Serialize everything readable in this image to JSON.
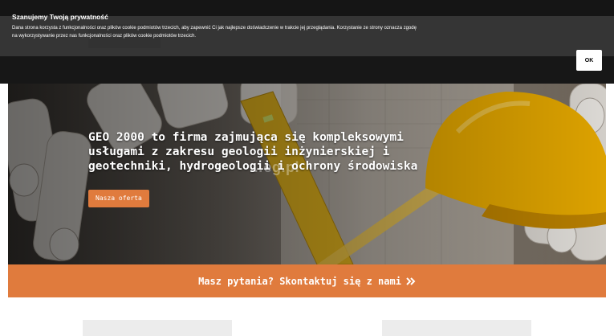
{
  "cookie": {
    "title": "Szanujemy Twoją prywatność",
    "text": "Dana strona korzysta z funkcjonalności oraz plików cookie podmiotów trzecich, aby zapewnić Ci jak najlepsze doświadczenie w trakcie jej przeglądania. Korzystanie ze strony oznacza zgodę na wykorzystywanie przez nas funkcjonalności oraz plików cookie podmiotów trzecich.",
    "ok_label": "OK"
  },
  "hero": {
    "title": "GEO 2000 to firma zajmująca się kompleksowymi usługami z zakresu geologii inżynierskiej i geotechniki, hydrogeologii i ochrony środowiska",
    "button_label": "Nasza oferta",
    "watermark": "…eg.pl"
  },
  "contact": {
    "label": "Masz pytania? Skontaktuj się z nami"
  },
  "colors": {
    "accent": "#e07b3d",
    "overlay": "#141414"
  }
}
